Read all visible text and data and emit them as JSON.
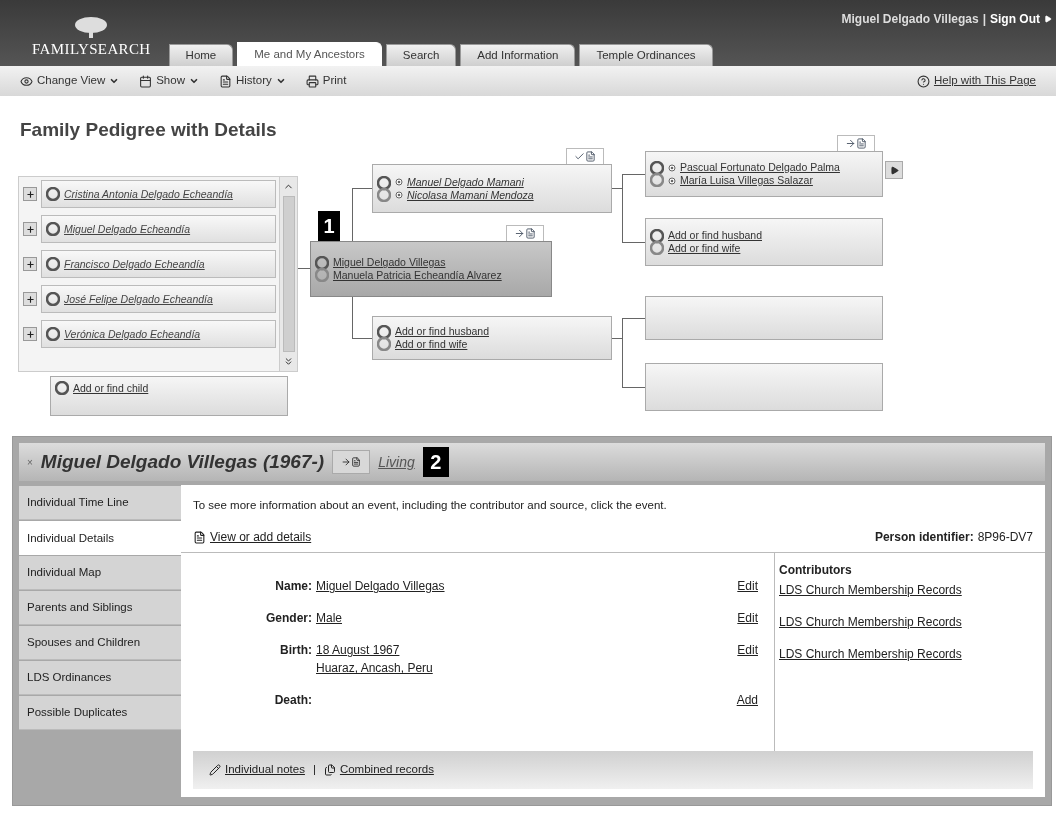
{
  "header": {
    "logo": "FAMILYSEARCH",
    "user": "Miguel Delgado Villegas",
    "separator": "|",
    "sign_out": "Sign Out"
  },
  "tabs": [
    {
      "label": "Home",
      "selected": false
    },
    {
      "label": "Me and My Ancestors",
      "selected": true
    },
    {
      "label": "Search",
      "selected": false
    },
    {
      "label": "Add Information",
      "selected": false
    },
    {
      "label": "Temple Ordinances",
      "selected": false
    }
  ],
  "toolbar": {
    "items": [
      {
        "label": "Change View",
        "kind": "menu"
      },
      {
        "label": "Show",
        "kind": "menu"
      },
      {
        "label": "History",
        "kind": "menu"
      },
      {
        "label": "Print",
        "kind": "action"
      }
    ],
    "help": "Help with This Page"
  },
  "title": "Family Pedigree with Details",
  "pedigree": {
    "children": [
      "Cristina Antonia Delgado Echeandía",
      "Miguel Delgado Echeandía",
      "Francisco Delgado Echeandía",
      "José Felipe Delgado Echeandía",
      "Verónica Delgado Echeandía"
    ],
    "add_child": "Add or find child",
    "callout": "1",
    "boxes": [
      {
        "kind": "couple",
        "focus": true,
        "flag": true,
        "verified": false,
        "names": [
          "Miguel Delgado Villegas",
          "Manuela Patricia Echeandía Alvarez"
        ]
      },
      {
        "kind": "couple",
        "focus": false,
        "flag": true,
        "verified": true,
        "names": [
          "Manuel Delgado Mamani",
          "Nicolasa Mamani Mendoza"
        ]
      },
      {
        "kind": "add",
        "focus": false,
        "names": [
          "Add or find husband",
          "Add or find wife"
        ]
      },
      {
        "kind": "couple",
        "focus": false,
        "flag": true,
        "verified": false,
        "expand": true,
        "names": [
          "Pascual Fortunato Delgado Palma",
          "María Luisa Villegas Salazar"
        ]
      },
      {
        "kind": "add",
        "focus": false,
        "names": [
          "Add or find husband",
          "Add or find wife"
        ]
      },
      {
        "kind": "empty",
        "focus": false
      },
      {
        "kind": "empty",
        "focus": false
      }
    ]
  },
  "details": {
    "close": "×",
    "heading": "Miguel Delgado Villegas (1967-)",
    "status": "Living",
    "callout": "2",
    "side_tabs": [
      {
        "label": "Individual Time Line",
        "selected": false
      },
      {
        "label": "Individual Details",
        "selected": true
      },
      {
        "label": "Individual Map",
        "selected": false
      },
      {
        "label": "Parents and Siblings",
        "selected": false
      },
      {
        "label": "Spouses and Children",
        "selected": false
      },
      {
        "label": "LDS Ordinances",
        "selected": false
      },
      {
        "label": "Possible Duplicates",
        "selected": false
      }
    ],
    "hint": "To see more information about an event, including the contributor and source, click the event.",
    "view_link": "View or add details",
    "identifier_label": "Person identifier:",
    "identifier": "8P96-DV7",
    "contributors_heading": "Contributors",
    "facts": [
      {
        "label": "Name:",
        "value": [
          "Miguel Delgado Villegas"
        ],
        "action": "Edit",
        "contributor": "LDS Church Membership Records"
      },
      {
        "label": "Gender:",
        "value": [
          "Male"
        ],
        "action": "Edit",
        "contributor": "LDS Church Membership Records"
      },
      {
        "label": "Birth:",
        "value": [
          "18 August 1967",
          "Huaraz, Ancash, Peru"
        ],
        "action": "Edit",
        "contributor": "LDS Church Membership Records"
      },
      {
        "label": "Death:",
        "action": "Add"
      }
    ],
    "footer": {
      "links": [
        {
          "label": "Individual notes",
          "kind": "notes"
        },
        {
          "label": "Combined records",
          "kind": "records"
        }
      ],
      "separator": "|"
    }
  }
}
